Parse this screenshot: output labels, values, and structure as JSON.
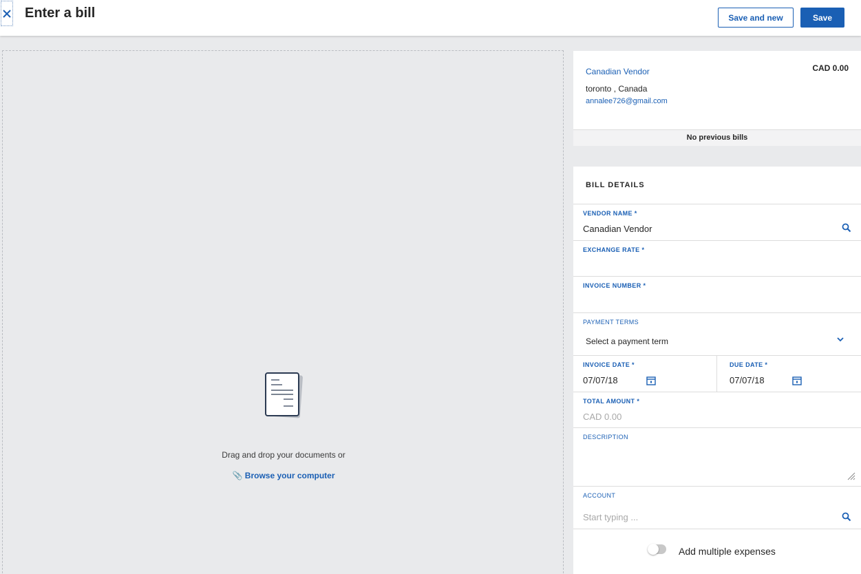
{
  "header": {
    "title": "Enter a bill",
    "save_and_new_label": "Save and new",
    "save_label": "Save"
  },
  "dropzone": {
    "instruction": "Drag and drop your documents or",
    "browse_label": "Browse your computer"
  },
  "vendor": {
    "name": "Canadian Vendor",
    "amount": "CAD 0.00",
    "location": "toronto , Canada",
    "email": "annalee726@gmail.com",
    "previous_bills": "No previous bills"
  },
  "bill_details": {
    "title": "BILL DETAILS",
    "vendor_name_label": "VENDOR NAME *",
    "vendor_name_value": "Canadian Vendor",
    "exchange_rate_label": "EXCHANGE RATE *",
    "exchange_rate_value": "",
    "invoice_number_label": "INVOICE NUMBER *",
    "invoice_number_value": "",
    "payment_terms_label": "PAYMENT TERMS",
    "payment_terms_value": "Select a payment term",
    "invoice_date_label": "INVOICE DATE *",
    "invoice_date_value": "07/07/18",
    "due_date_label": "DUE DATE *",
    "due_date_value": "07/07/18",
    "total_amount_label": "TOTAL AMOUNT *",
    "total_amount_placeholder": "CAD 0.00",
    "description_label": "DESCRIPTION",
    "description_value": "",
    "account_label": "ACCOUNT",
    "account_placeholder": "Start typing ...",
    "multiple_expenses_label": "Add multiple expenses",
    "multiple_expenses_enabled": false
  },
  "icons": {
    "close": "close-icon",
    "search": "search-icon",
    "chevron": "chevron-down-icon",
    "calendar": "calendar-icon",
    "paperclip": "paperclip-icon",
    "document": "document-icon"
  },
  "colors": {
    "accent": "#1a5fb4",
    "background": "#e9eaec"
  }
}
